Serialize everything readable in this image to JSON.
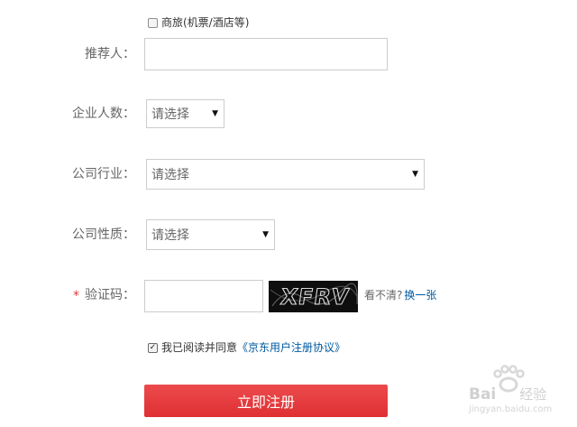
{
  "business_travel": {
    "label": "商旅(机票/酒店等)",
    "checked": false
  },
  "referrer": {
    "label": "推荐人：",
    "value": ""
  },
  "company_size": {
    "label": "企业人数：",
    "selected": "请选择"
  },
  "company_industry": {
    "label": "公司行业：",
    "selected": "请选择"
  },
  "company_nature": {
    "label": "公司性质：",
    "selected": "请选择"
  },
  "captcha": {
    "required_mark": "*",
    "label": "验证码：",
    "value": "",
    "image_text": "XFRV",
    "hint": "看不清?",
    "refresh_link": "换一张"
  },
  "agreement": {
    "checked": true,
    "prefix": "我已阅读并同意",
    "link": "《京东用户注册协议》"
  },
  "submit": {
    "label": "立即注册"
  },
  "watermark": {
    "brand": "Bai",
    "brand2": "经验",
    "url": "jingyan.baidu.com"
  },
  "colors": {
    "accent": "#e4393c",
    "link": "#005aa0"
  }
}
